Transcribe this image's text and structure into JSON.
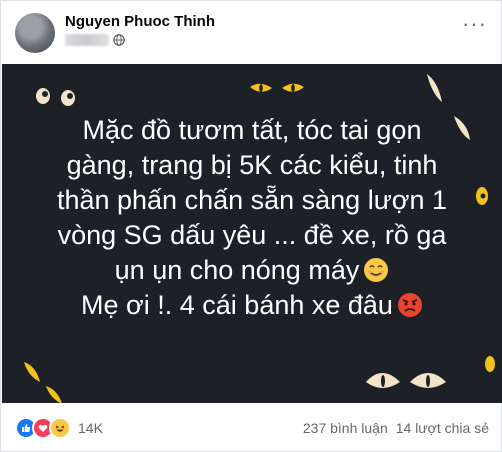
{
  "post": {
    "author": "Nguyen Phuoc Thinh",
    "lines": [
      "Mặc đồ tươm tất, tóc tai gọn",
      "gàng, trang bị 5K các kiểu, tinh",
      "thần phấn chấn sẵn sàng lượn 1",
      "vòng SG dấu yêu ... đề xe, rồ ga",
      "ụn ụn cho nóng máy",
      "Mẹ ơi !. 4 cái bánh xe đâu"
    ],
    "background_color": "#1d2027",
    "text_color": "#ffffff"
  },
  "icons": {
    "privacy": "globe-icon",
    "more": "more-horizontal-icon",
    "smile": "smiling-face-emoji",
    "angry": "angry-face-emoji",
    "reactions": [
      "like-icon",
      "love-icon",
      "haha-icon"
    ]
  },
  "footer": {
    "reactions_count": "14K",
    "comments": "237 bình luận",
    "shares": "14 lượt chia sẻ"
  }
}
